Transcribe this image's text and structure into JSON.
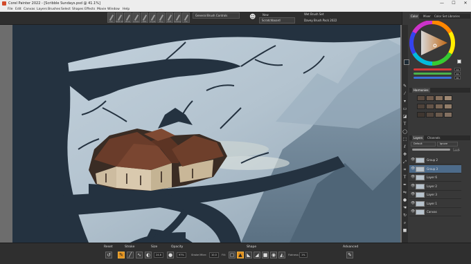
{
  "window": {
    "title": "Corel Painter 2022 - [Scribble Sundays.psd @ 41.1%]",
    "minimize": "—",
    "maximize": "☐",
    "close": "✕"
  },
  "menu": [
    "File",
    "Edit",
    "Canvas",
    "Layers",
    "Brushes",
    "Select",
    "Shapes",
    "Effects",
    "Movie",
    "Window",
    "Help"
  ],
  "toolbar": {
    "brush_slots": [
      "Ink",
      "Mist Sh",
      "Blob",
      "Grain",
      "Wet",
      "Cryst",
      "Dry",
      "Soft",
      "Grainy",
      "Ink",
      "Light"
    ],
    "general_brush_controls": "General Brush Controls",
    "new_label": "New",
    "scratchboard": "Scratchboard",
    "brush_set": "Wet Brush Set",
    "brush_pack": "Davey Brush Pack 2022"
  },
  "color_panel": {
    "tabs": [
      "Color",
      "Mixer",
      "Color Set Libraries"
    ],
    "rgb_values": [
      "12",
      "42",
      "65"
    ],
    "slider_colors": [
      "#d83a3a",
      "#4bb34b",
      "#3a6fd8"
    ]
  },
  "harmonies": {
    "title": "Harmonies",
    "swatches": [
      "#5a4b41",
      "#6e5a4c",
      "#86705d",
      "#9e8873",
      "#4e423a",
      "#645448",
      "#7b6756",
      "#927d69",
      "#3f3630",
      "#54473e",
      "#6b5a4d",
      "#837061"
    ]
  },
  "layers": {
    "tabs": [
      "Layers",
      "Channels"
    ],
    "composite_method": "Default",
    "ignore": "Ignore",
    "opacity": "100%",
    "items": [
      {
        "name": "Group 2",
        "selected": false
      },
      {
        "name": "Group 3",
        "selected": true
      },
      {
        "name": "Layer 6",
        "selected": false
      },
      {
        "name": "Layer 2",
        "selected": false
      },
      {
        "name": "Layer 3",
        "selected": false
      },
      {
        "name": "Layer 1",
        "selected": false
      },
      {
        "name": "Canvas",
        "selected": false
      }
    ]
  },
  "bottombar": {
    "reset": "Reset",
    "stroke": "Stroke",
    "size": "Size",
    "opacity": "Opacity",
    "size_value": "24.8",
    "opacity_value": "97%",
    "stroke_miter": "Stroke Miter:",
    "miter_value": "10.0",
    "fill": "Fill:",
    "shape": "Shape",
    "flatness": "Flatness:",
    "flatness_value": "1%",
    "advanced": "Advanced"
  },
  "colors": {
    "accent": "#e0901f",
    "selection": "#4d6b8a",
    "sky": "#b6c5d2",
    "tree": "#243240",
    "roof": "#6a3c2a"
  }
}
